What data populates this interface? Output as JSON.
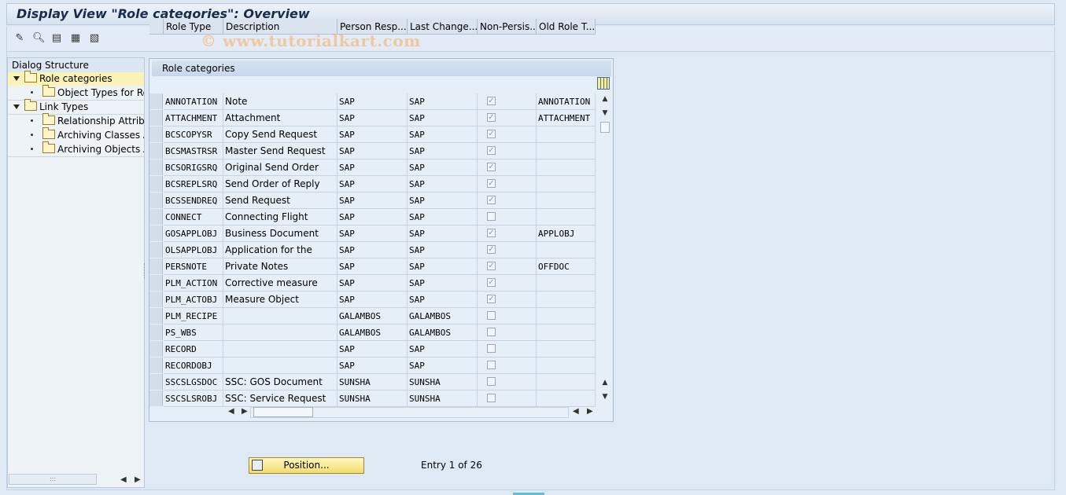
{
  "window": {
    "title": "Display View \"Role categories\": Overview",
    "watermark": "© www.tutorialkart.com"
  },
  "toolbar": {
    "icons": [
      "change-display-icon",
      "find-icon",
      "select-all-icon",
      "select-block-icon",
      "deselect-all-icon"
    ]
  },
  "tree": {
    "header": "Dialog Structure",
    "items": [
      {
        "label": "Role categories",
        "level": 0,
        "expanded": true,
        "selected": true
      },
      {
        "label": "Object Types for Rol",
        "level": 1
      },
      {
        "label": "Link Types",
        "level": 0,
        "expanded": true
      },
      {
        "label": "Relationship Attribute",
        "level": 1
      },
      {
        "label": "Archiving Classes Ass",
        "level": 1
      },
      {
        "label": "Archiving Objects As",
        "level": 1
      }
    ]
  },
  "table": {
    "title": "Role categories",
    "columns": [
      "Role Type",
      "Description",
      "Person Resp...",
      "Last Change...",
      "Non-Persis...",
      "Old Role T..."
    ],
    "rows": [
      {
        "role": "ANNOTATION",
        "desc": "Note",
        "person": "SAP",
        "last": "SAP",
        "nonpers": true,
        "old": "ANNOTATION"
      },
      {
        "role": "ATTACHMENT",
        "desc": "Attachment",
        "person": "SAP",
        "last": "SAP",
        "nonpers": true,
        "old": "ATTACHMENT"
      },
      {
        "role": "BCSCOPYSR",
        "desc": "Copy Send Request",
        "person": "SAP",
        "last": "SAP",
        "nonpers": true,
        "old": ""
      },
      {
        "role": "BCSMASTRSR",
        "desc": "Master Send Request",
        "person": "SAP",
        "last": "SAP",
        "nonpers": true,
        "old": ""
      },
      {
        "role": "BCSORIGSRQ",
        "desc": "Original Send Order",
        "person": "SAP",
        "last": "SAP",
        "nonpers": true,
        "old": ""
      },
      {
        "role": "BCSREPLSRQ",
        "desc": "Send Order of Reply",
        "person": "SAP",
        "last": "SAP",
        "nonpers": true,
        "old": ""
      },
      {
        "role": "BCSSENDREQ",
        "desc": "Send Request",
        "person": "SAP",
        "last": "SAP",
        "nonpers": true,
        "old": ""
      },
      {
        "role": "CONNECT",
        "desc": "Connecting Flight",
        "person": "SAP",
        "last": "SAP",
        "nonpers": false,
        "old": ""
      },
      {
        "role": "GOSAPPLOBJ",
        "desc": "Business Document",
        "person": "SAP",
        "last": "SAP",
        "nonpers": true,
        "old": "APPLOBJ"
      },
      {
        "role": "OLSAPPLOBJ",
        "desc": "Application for the",
        "person": "SAP",
        "last": "SAP",
        "nonpers": true,
        "old": ""
      },
      {
        "role": "PERSNOTE",
        "desc": "Private Notes",
        "person": "SAP",
        "last": "SAP",
        "nonpers": true,
        "old": "OFFDOC"
      },
      {
        "role": "PLM_ACTION",
        "desc": "Corrective measure",
        "person": "SAP",
        "last": "SAP",
        "nonpers": true,
        "old": ""
      },
      {
        "role": "PLM_ACTOBJ",
        "desc": "Measure Object",
        "person": "SAP",
        "last": "SAP",
        "nonpers": true,
        "old": ""
      },
      {
        "role": "PLM_RECIPE",
        "desc": "",
        "person": "GALAMBOS",
        "last": "GALAMBOS",
        "nonpers": false,
        "old": ""
      },
      {
        "role": "PS_WBS",
        "desc": "",
        "person": "GALAMBOS",
        "last": "GALAMBOS",
        "nonpers": false,
        "old": ""
      },
      {
        "role": "RECORD",
        "desc": "",
        "person": "SAP",
        "last": "SAP",
        "nonpers": false,
        "old": ""
      },
      {
        "role": "RECORDOBJ",
        "desc": "",
        "person": "SAP",
        "last": "SAP",
        "nonpers": false,
        "old": ""
      },
      {
        "role": "SSCSLGSDOC",
        "desc": "SSC: GOS Document",
        "person": "SUNSHA",
        "last": "SUNSHA",
        "nonpers": false,
        "old": ""
      },
      {
        "role": "SSCSLSROBJ",
        "desc": "SSC: Service Request",
        "person": "SUNSHA",
        "last": "SUNSHA",
        "nonpers": false,
        "old": ""
      }
    ]
  },
  "footer": {
    "position_label": "Position...",
    "entry_text": "Entry 1 of 26"
  }
}
